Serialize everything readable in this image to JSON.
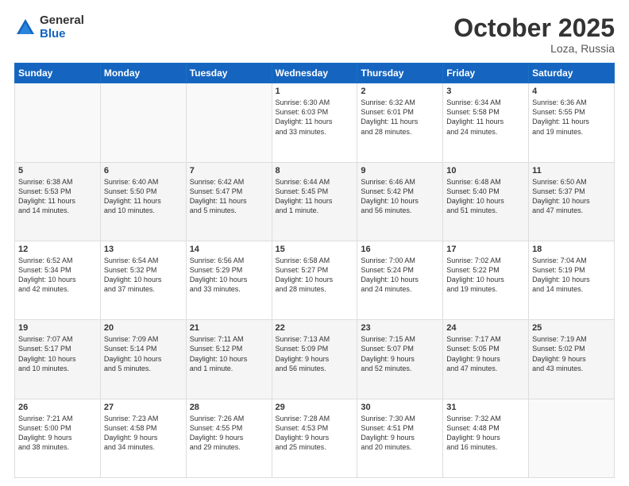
{
  "header": {
    "logo_general": "General",
    "logo_blue": "Blue",
    "title": "October 2025",
    "location": "Loza, Russia"
  },
  "weekdays": [
    "Sunday",
    "Monday",
    "Tuesday",
    "Wednesday",
    "Thursday",
    "Friday",
    "Saturday"
  ],
  "weeks": [
    [
      {
        "day": "",
        "info": ""
      },
      {
        "day": "",
        "info": ""
      },
      {
        "day": "",
        "info": ""
      },
      {
        "day": "1",
        "info": "Sunrise: 6:30 AM\nSunset: 6:03 PM\nDaylight: 11 hours\nand 33 minutes."
      },
      {
        "day": "2",
        "info": "Sunrise: 6:32 AM\nSunset: 6:01 PM\nDaylight: 11 hours\nand 28 minutes."
      },
      {
        "day": "3",
        "info": "Sunrise: 6:34 AM\nSunset: 5:58 PM\nDaylight: 11 hours\nand 24 minutes."
      },
      {
        "day": "4",
        "info": "Sunrise: 6:36 AM\nSunset: 5:55 PM\nDaylight: 11 hours\nand 19 minutes."
      }
    ],
    [
      {
        "day": "5",
        "info": "Sunrise: 6:38 AM\nSunset: 5:53 PM\nDaylight: 11 hours\nand 14 minutes."
      },
      {
        "day": "6",
        "info": "Sunrise: 6:40 AM\nSunset: 5:50 PM\nDaylight: 11 hours\nand 10 minutes."
      },
      {
        "day": "7",
        "info": "Sunrise: 6:42 AM\nSunset: 5:47 PM\nDaylight: 11 hours\nand 5 minutes."
      },
      {
        "day": "8",
        "info": "Sunrise: 6:44 AM\nSunset: 5:45 PM\nDaylight: 11 hours\nand 1 minute."
      },
      {
        "day": "9",
        "info": "Sunrise: 6:46 AM\nSunset: 5:42 PM\nDaylight: 10 hours\nand 56 minutes."
      },
      {
        "day": "10",
        "info": "Sunrise: 6:48 AM\nSunset: 5:40 PM\nDaylight: 10 hours\nand 51 minutes."
      },
      {
        "day": "11",
        "info": "Sunrise: 6:50 AM\nSunset: 5:37 PM\nDaylight: 10 hours\nand 47 minutes."
      }
    ],
    [
      {
        "day": "12",
        "info": "Sunrise: 6:52 AM\nSunset: 5:34 PM\nDaylight: 10 hours\nand 42 minutes."
      },
      {
        "day": "13",
        "info": "Sunrise: 6:54 AM\nSunset: 5:32 PM\nDaylight: 10 hours\nand 37 minutes."
      },
      {
        "day": "14",
        "info": "Sunrise: 6:56 AM\nSunset: 5:29 PM\nDaylight: 10 hours\nand 33 minutes."
      },
      {
        "day": "15",
        "info": "Sunrise: 6:58 AM\nSunset: 5:27 PM\nDaylight: 10 hours\nand 28 minutes."
      },
      {
        "day": "16",
        "info": "Sunrise: 7:00 AM\nSunset: 5:24 PM\nDaylight: 10 hours\nand 24 minutes."
      },
      {
        "day": "17",
        "info": "Sunrise: 7:02 AM\nSunset: 5:22 PM\nDaylight: 10 hours\nand 19 minutes."
      },
      {
        "day": "18",
        "info": "Sunrise: 7:04 AM\nSunset: 5:19 PM\nDaylight: 10 hours\nand 14 minutes."
      }
    ],
    [
      {
        "day": "19",
        "info": "Sunrise: 7:07 AM\nSunset: 5:17 PM\nDaylight: 10 hours\nand 10 minutes."
      },
      {
        "day": "20",
        "info": "Sunrise: 7:09 AM\nSunset: 5:14 PM\nDaylight: 10 hours\nand 5 minutes."
      },
      {
        "day": "21",
        "info": "Sunrise: 7:11 AM\nSunset: 5:12 PM\nDaylight: 10 hours\nand 1 minute."
      },
      {
        "day": "22",
        "info": "Sunrise: 7:13 AM\nSunset: 5:09 PM\nDaylight: 9 hours\nand 56 minutes."
      },
      {
        "day": "23",
        "info": "Sunrise: 7:15 AM\nSunset: 5:07 PM\nDaylight: 9 hours\nand 52 minutes."
      },
      {
        "day": "24",
        "info": "Sunrise: 7:17 AM\nSunset: 5:05 PM\nDaylight: 9 hours\nand 47 minutes."
      },
      {
        "day": "25",
        "info": "Sunrise: 7:19 AM\nSunset: 5:02 PM\nDaylight: 9 hours\nand 43 minutes."
      }
    ],
    [
      {
        "day": "26",
        "info": "Sunrise: 7:21 AM\nSunset: 5:00 PM\nDaylight: 9 hours\nand 38 minutes."
      },
      {
        "day": "27",
        "info": "Sunrise: 7:23 AM\nSunset: 4:58 PM\nDaylight: 9 hours\nand 34 minutes."
      },
      {
        "day": "28",
        "info": "Sunrise: 7:26 AM\nSunset: 4:55 PM\nDaylight: 9 hours\nand 29 minutes."
      },
      {
        "day": "29",
        "info": "Sunrise: 7:28 AM\nSunset: 4:53 PM\nDaylight: 9 hours\nand 25 minutes."
      },
      {
        "day": "30",
        "info": "Sunrise: 7:30 AM\nSunset: 4:51 PM\nDaylight: 9 hours\nand 20 minutes."
      },
      {
        "day": "31",
        "info": "Sunrise: 7:32 AM\nSunset: 4:48 PM\nDaylight: 9 hours\nand 16 minutes."
      },
      {
        "day": "",
        "info": ""
      }
    ]
  ]
}
